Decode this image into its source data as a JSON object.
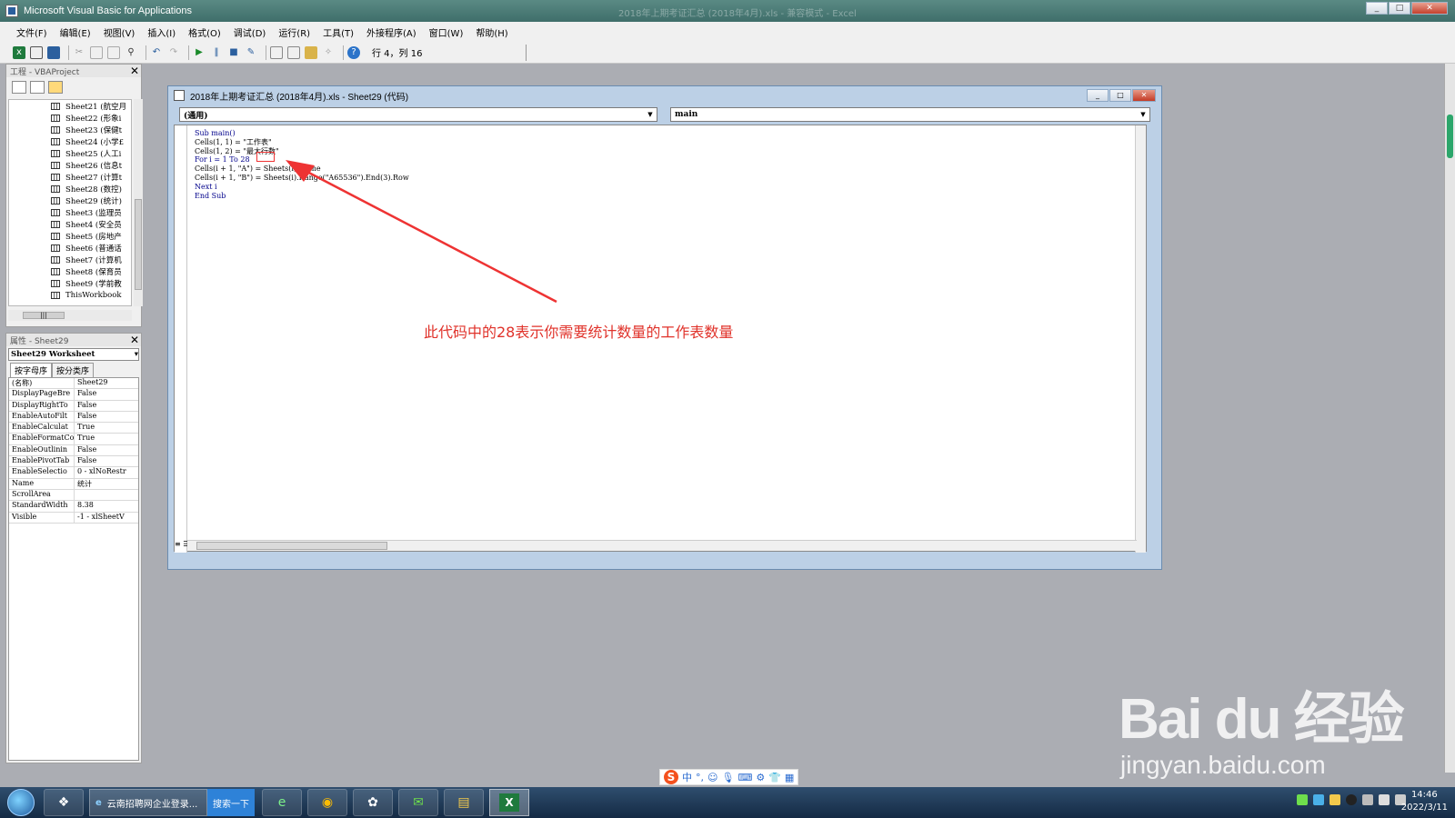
{
  "window": {
    "title": "Microsoft Visual Basic for Applications",
    "faded_title": "2018年上期考证汇总 (2018年4月).xls - 兼容模式 - Excel"
  },
  "menu": [
    "文件(F)",
    "编辑(E)",
    "视图(V)",
    "插入(I)",
    "格式(O)",
    "调试(D)",
    "运行(R)",
    "工具(T)",
    "外接程序(A)",
    "窗口(W)",
    "帮助(H)"
  ],
  "toolbar": {
    "cursor_position": "行 4，列 16"
  },
  "project_panel": {
    "title": "工程 - VBAProject",
    "items": [
      "Sheet21 (航空月",
      "Sheet22 (形象i",
      "Sheet23 (保健t",
      "Sheet24 (小学£",
      "Sheet25 (人工i",
      "Sheet26 (信息t",
      "Sheet27 (计算t",
      "Sheet28 (数控)",
      "Sheet29 (统计)",
      "Sheet3 (监理员",
      "Sheet4 (安全员",
      "Sheet5 (房地产",
      "Sheet6 (普通话",
      "Sheet7 (计算机",
      "Sheet8 (保育员",
      "Sheet9 (学前教",
      "ThisWorkbook"
    ]
  },
  "properties_panel": {
    "title": "属性 - Sheet29",
    "object": "Sheet29 Worksheet",
    "tabs": [
      "按字母序",
      "按分类序"
    ],
    "rows": [
      {
        "k": "(名称)",
        "v": "Sheet29"
      },
      {
        "k": "DisplayPageBre",
        "v": "False"
      },
      {
        "k": "DisplayRightTo",
        "v": "False"
      },
      {
        "k": "EnableAutoFilt",
        "v": "False"
      },
      {
        "k": "EnableCalculat",
        "v": "True"
      },
      {
        "k": "EnableFormatCo",
        "v": "True"
      },
      {
        "k": "EnableOutlinin",
        "v": "False"
      },
      {
        "k": "EnablePivotTab",
        "v": "False"
      },
      {
        "k": "EnableSelectio",
        "v": "0 - xlNoRestr"
      },
      {
        "k": "Name",
        "v": "统计"
      },
      {
        "k": "ScrollArea",
        "v": ""
      },
      {
        "k": "StandardWidth",
        "v": "8.38"
      },
      {
        "k": "Visible",
        "v": "-1 - xlSheetV"
      }
    ]
  },
  "code_window": {
    "title": "2018年上期考证汇总 (2018年4月).xls - Sheet29 (代码)",
    "object_combo": "(通用)",
    "proc_combo": "main",
    "lines": [
      "Sub main()",
      "Cells(1, 1) = \"工作表\"",
      "Cells(1, 2) = \"最大行数\"",
      "For i = 1 To 28",
      "Cells(i + 1, \"A\") = Sheets(i).Name",
      "Cells(i + 1, \"B\") = Sheets(i).Range(\"A65536\").End(3).Row",
      "Next i",
      "End Sub"
    ]
  },
  "annotation": "此代码中的28表示你需要统计数量的工作表数量",
  "ime": {
    "label": "中"
  },
  "taskbar": {
    "ie_label": "云南招聘网企业登录...",
    "search_label": "搜索一下",
    "time": "14:46",
    "date": "2022/3/11"
  },
  "watermark": {
    "logo": "Bai du 经验",
    "url": "jingyan.baidu.com"
  },
  "colors": {
    "annotation": "#e0322a",
    "titlebar": "#3f6e6a",
    "keyword": "#00008b"
  }
}
